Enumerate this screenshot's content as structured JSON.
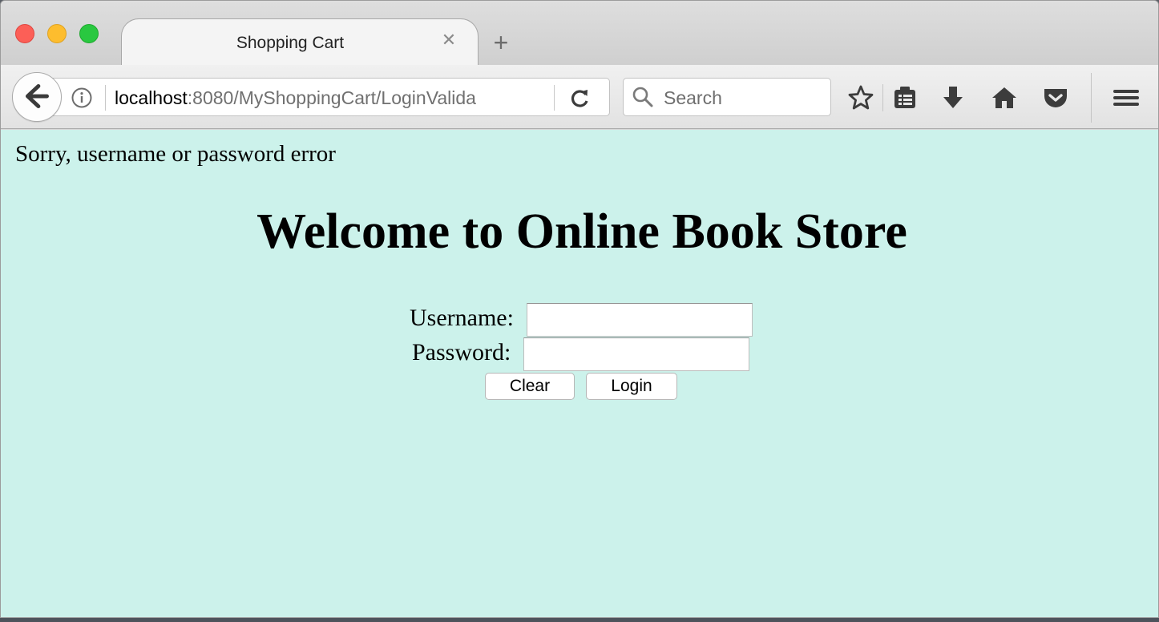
{
  "browser": {
    "tab_title": "Shopping Cart",
    "tab_close": "✕",
    "new_tab": "+",
    "url_host": "localhost",
    "url_rest": ":8080/MyShoppingCart/LoginValida",
    "search_placeholder": "Search",
    "icons": [
      "back-arrow-icon",
      "info-icon",
      "reload-icon",
      "search-icon",
      "bookmark-star-icon",
      "reading-list-icon",
      "download-icon",
      "home-icon",
      "pocket-icon",
      "hamburger-menu-icon"
    ]
  },
  "page": {
    "background": "#ccf2eb",
    "error_message": "Sorry, username or password error",
    "heading": "Welcome to Online Book Store",
    "username_label": "Username:",
    "password_label": "Password:",
    "clear_label": "Clear",
    "login_label": "Login"
  }
}
